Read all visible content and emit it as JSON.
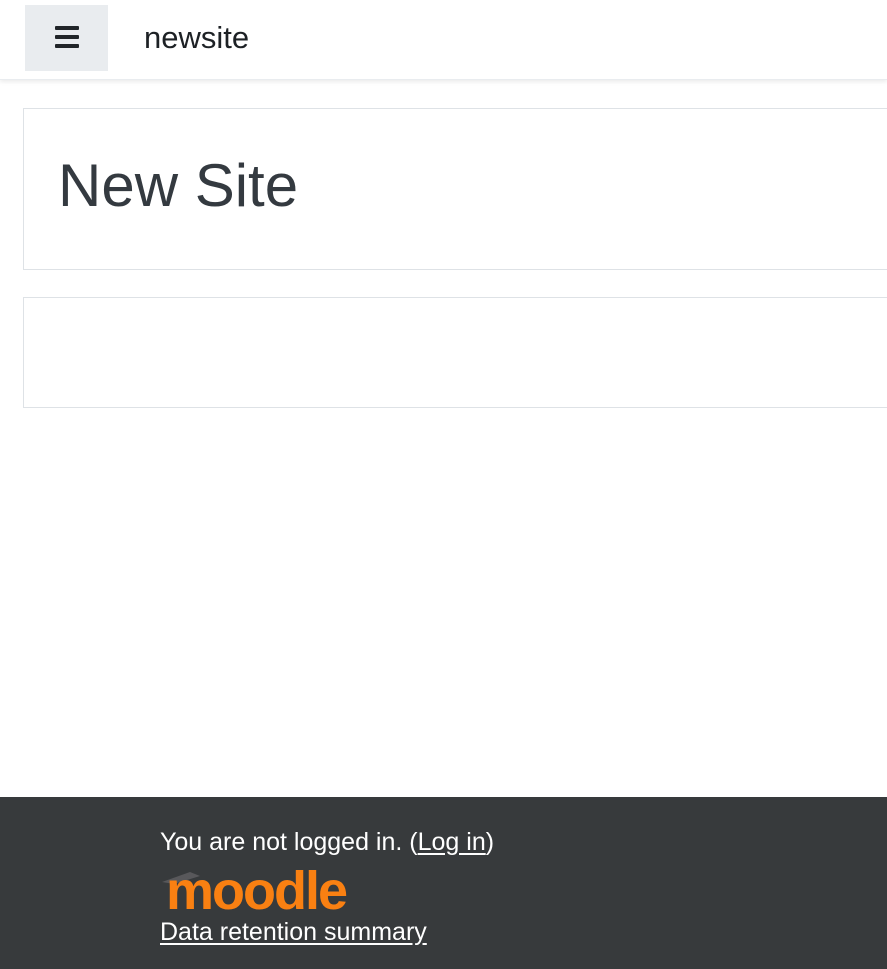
{
  "navbar": {
    "menu_toggle_icon": "hamburger-icon",
    "site_name": "newsite"
  },
  "header": {
    "title": "New Site"
  },
  "footer": {
    "login_prefix": "You are not logged in. (",
    "login_link": "Log in",
    "login_suffix": ")",
    "logo_text": "moodle",
    "data_retention_link": "Data retention summary"
  },
  "colors": {
    "footer_bg": "#373a3c",
    "logo_orange": "#f98012",
    "logo_cap": "#58585b",
    "toggle_bg": "#e9ecef"
  }
}
